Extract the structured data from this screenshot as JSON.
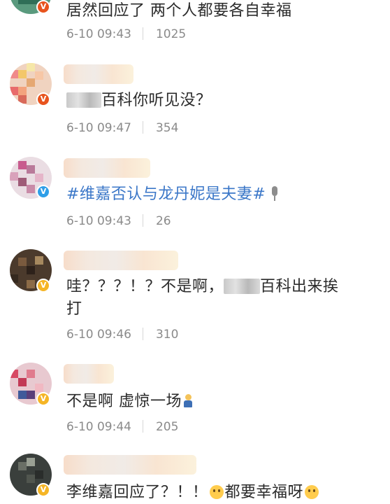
{
  "comments": [
    {
      "text": "居然回应了 两个人都要各自幸福",
      "time": "6-10 09:43",
      "likes": "1025",
      "badge": "V",
      "badge_color": "#e8541e"
    },
    {
      "text_after_redact": "百科你听见没？",
      "time": "6-10 09:47",
      "likes": "354",
      "badge": "V",
      "badge_color": "#e8541e"
    },
    {
      "hashtag": "#维嘉否认与龙丹妮是夫妻#",
      "hashtag_icon": "microphone-icon",
      "time": "6-10 09:43",
      "likes": "26",
      "badge": "V",
      "badge_color": "#2f9fe8"
    },
    {
      "text_before_redact": "哇？？？！？不是啊，",
      "text_after_redact": "百科出来挨",
      "text_line2": "打",
      "time": "6-10 09:46",
      "likes": "310",
      "badge": "V",
      "badge_color": "#f5b526"
    },
    {
      "text": "不是啊 虚惊一场",
      "text_emoji": "person-emoji",
      "time": "6-10 09:44",
      "likes": "205",
      "badge": "V",
      "badge_color": "#f5b526"
    },
    {
      "text_part1": "李维嘉回应了？！！",
      "text_part2": "都要幸福呀",
      "text_emoji": "smile-emoji",
      "badge": "V",
      "badge_color": "#f5b526"
    }
  ]
}
